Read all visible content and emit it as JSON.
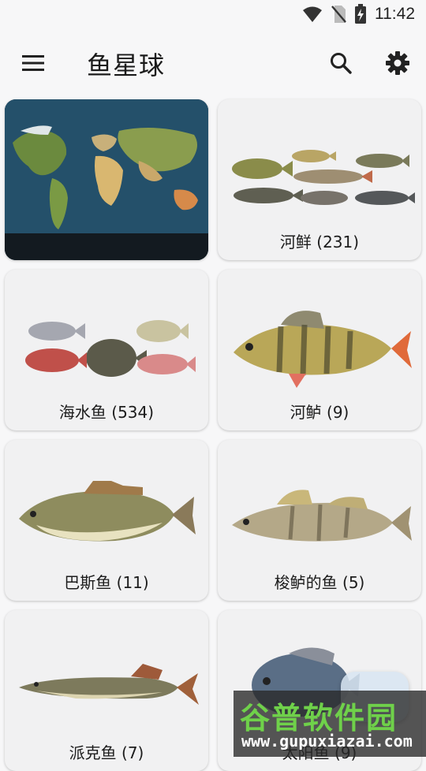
{
  "status": {
    "time": "11:42",
    "icons": [
      "wifi-icon",
      "no-sim-icon",
      "battery-charging-icon"
    ]
  },
  "appbar": {
    "title": "鱼星球",
    "menu_icon": "menu-icon",
    "search_icon": "search-icon",
    "settings_icon": "gear-icon"
  },
  "categories": [
    {
      "label": ""
    },
    {
      "label": "河鲜 (231)"
    },
    {
      "label": "海水鱼 (534)"
    },
    {
      "label": "河鲈 (9)"
    },
    {
      "label": "巴斯鱼 (11)"
    },
    {
      "label": "梭鲈的鱼 (5)"
    },
    {
      "label": "派克鱼 (7)"
    },
    {
      "label": "太阳鱼 (9)"
    }
  ],
  "watermark": {
    "title": "谷普软件园",
    "url": "www.gupuxiazai.com"
  }
}
